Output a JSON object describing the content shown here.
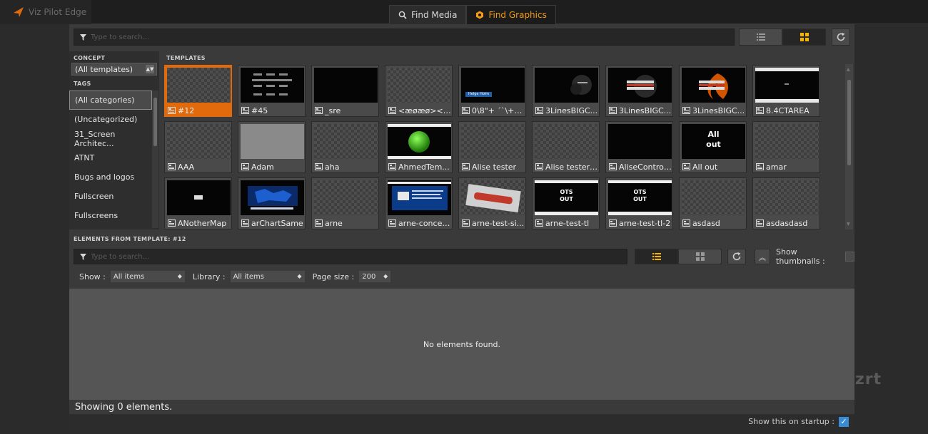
{
  "app": {
    "title": "Viz Pilot Edge"
  },
  "tabs": [
    {
      "label": "Find Media",
      "icon": "search-icon",
      "active": false
    },
    {
      "label": "Find Graphics",
      "icon": "graphics-icon",
      "active": true
    }
  ],
  "search": {
    "placeholder": "Type to search..."
  },
  "concept": {
    "header": "CONCEPT",
    "selected": "(All templates)"
  },
  "tags": {
    "header": "TAGS",
    "items": [
      "(All categories)",
      "(Uncategorized)",
      "31_Screen Architec...",
      "ATNT",
      "Bugs and logos",
      "Fullscreen",
      "Fullscreens"
    ],
    "selected_index": 0
  },
  "templates": {
    "header": "TEMPLATES",
    "items": [
      {
        "label": "#12",
        "thumb": "checker",
        "selected": true
      },
      {
        "label": "#45",
        "thumb": "text"
      },
      {
        "label": "_sre",
        "thumb": "black"
      },
      {
        "label": "<æøæø><a ...",
        "thumb": "checker"
      },
      {
        "label": "0\\8\"+ ´`\\+9'...",
        "thumb": "lowerthird",
        "thumb_text": "Helge Holm"
      },
      {
        "label": "3LinesBIGC...",
        "thumb": "smoke"
      },
      {
        "label": "3LinesBIGC...",
        "thumb": "bars"
      },
      {
        "label": "3LinesBIGC...",
        "thumb": "fire"
      },
      {
        "label": "8.4CTAREA",
        "thumb": "area"
      },
      {
        "label": "AAA",
        "thumb": "checker"
      },
      {
        "label": "Adam",
        "thumb": "gray"
      },
      {
        "label": "aha",
        "thumb": "checker"
      },
      {
        "label": "AhmedTem...",
        "thumb": "sphere"
      },
      {
        "label": "Alise tester",
        "thumb": "checker"
      },
      {
        "label": "Alise tester ...",
        "thumb": "checker"
      },
      {
        "label": "AliseControl...",
        "thumb": "black"
      },
      {
        "label": "All out",
        "thumb": "bigtext",
        "thumb_text": "All\nout"
      },
      {
        "label": "amar",
        "thumb": "checker"
      },
      {
        "label": "ANotherMap",
        "thumb": "smallbox"
      },
      {
        "label": "arChartSame",
        "thumb": "bluemap"
      },
      {
        "label": "arne",
        "thumb": "checker"
      },
      {
        "label": "arne-concep...",
        "thumb": "bluecard"
      },
      {
        "label": "arne-test-si...",
        "thumb": "redbanner"
      },
      {
        "label": "arne-test-tl",
        "thumb": "ots",
        "thumb_text": "OTS\nOUT"
      },
      {
        "label": "arne-test-tl-2",
        "thumb": "ots",
        "thumb_text": "OTS\nOUT"
      },
      {
        "label": "asdasd",
        "thumb": "checker"
      },
      {
        "label": "asdasdasd",
        "thumb": "checker"
      }
    ]
  },
  "elements": {
    "header": "ELEMENTS FROM TEMPLATE: #12",
    "search_placeholder": "Type to search...",
    "show_thumbnails_label": "Show thumbnails :",
    "show_label": "Show :",
    "show_value": "All items",
    "library_label": "Library :",
    "library_value": "All items",
    "page_size_label": "Page size :",
    "page_size_value": "200",
    "empty_text": "No elements found.",
    "status": "Showing 0 elements."
  },
  "footer": {
    "startup_label": "Show this on startup :",
    "startup_checked": true
  },
  "watermark": "zrt",
  "colors": {
    "accent": "#e06a0c",
    "tab_active": "#f39c12",
    "checkbox": "#3a8bd6"
  }
}
